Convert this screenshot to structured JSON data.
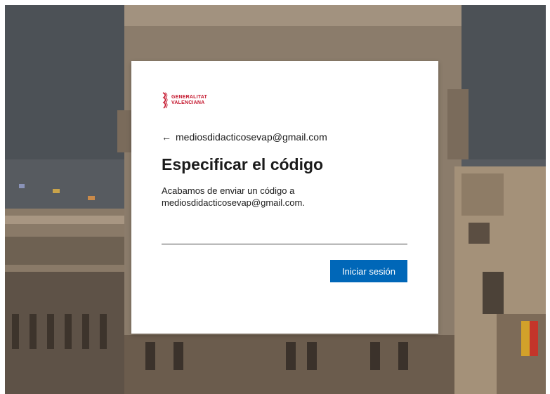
{
  "brand": {
    "line1": "GENERALITAT",
    "line2": "VALENCIANA",
    "color": "#c4152c"
  },
  "back": {
    "icon": "back-arrow-icon",
    "email": "mediosdidacticosevap@gmail.com"
  },
  "title": "Especificar el código",
  "description": "Acabamos de enviar un código a mediosdidacticosevap@gmail.com.",
  "code_input": {
    "value": "",
    "placeholder": ""
  },
  "submit_label": "Iniciar sesión",
  "colors": {
    "button": "#0067b8",
    "text": "#1b1b1b"
  }
}
